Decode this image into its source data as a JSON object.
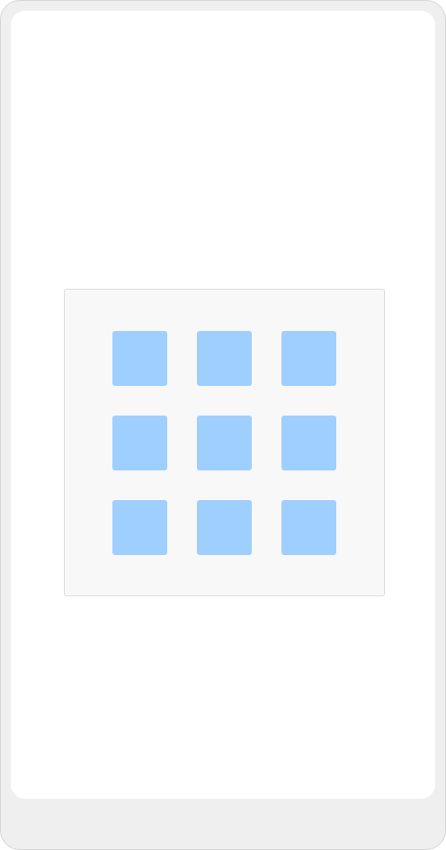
{
  "theme": {
    "frame_color": "#efefef",
    "screen_color": "#ffffff",
    "panel_color": "#f8f8f8",
    "tile_color": "#9ecfff"
  },
  "grid": {
    "rows": 3,
    "columns": 3,
    "tiles": [
      {
        "row": 1,
        "col": 1
      },
      {
        "row": 1,
        "col": 2
      },
      {
        "row": 1,
        "col": 3
      },
      {
        "row": 2,
        "col": 1
      },
      {
        "row": 2,
        "col": 2
      },
      {
        "row": 2,
        "col": 3
      },
      {
        "row": 3,
        "col": 1
      },
      {
        "row": 3,
        "col": 2
      },
      {
        "row": 3,
        "col": 3
      }
    ]
  }
}
